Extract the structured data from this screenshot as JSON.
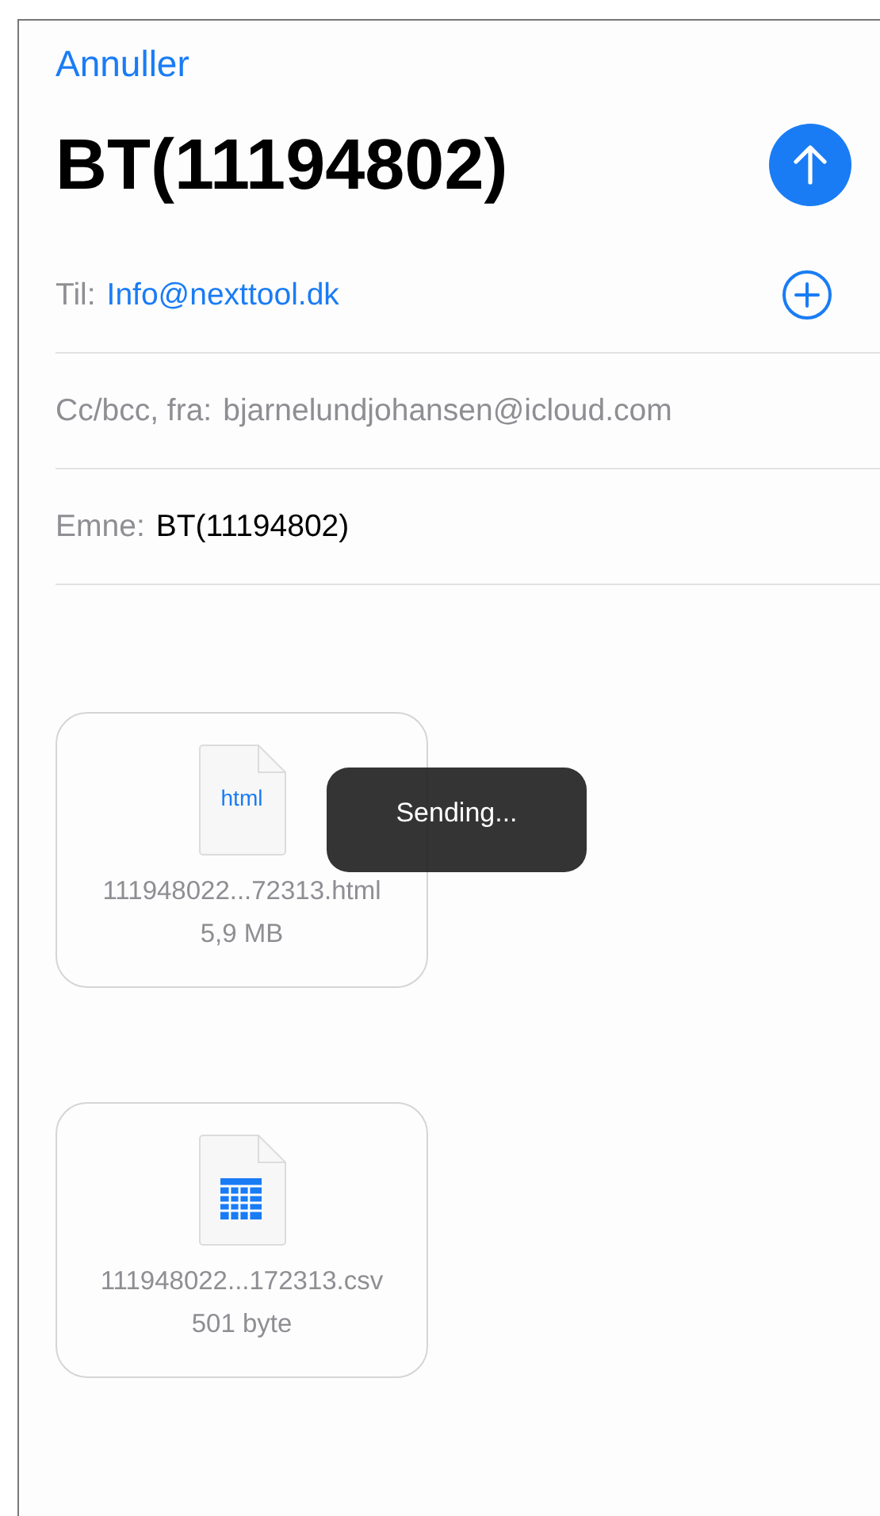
{
  "cancel": "Annuller",
  "title": "BT(11194802)",
  "fields": [
    {
      "label": "Til:",
      "value": "Info@nexttool.dk",
      "kind": "recipient"
    },
    {
      "label": "Cc/bcc, fra:",
      "value": "bjarnelundjohansen@icloud.com",
      "kind": "sender"
    },
    {
      "label": "Emne:",
      "value": "BT(11194802)",
      "kind": "subject"
    }
  ],
  "attachments": [
    {
      "kind": "html",
      "icon_text": "html",
      "name": "111948022...72313.html",
      "size": "5,9 MB"
    },
    {
      "kind": "table",
      "name": "111948022...172313.csv",
      "size": "501 byte"
    }
  ],
  "toast": "Sending..."
}
